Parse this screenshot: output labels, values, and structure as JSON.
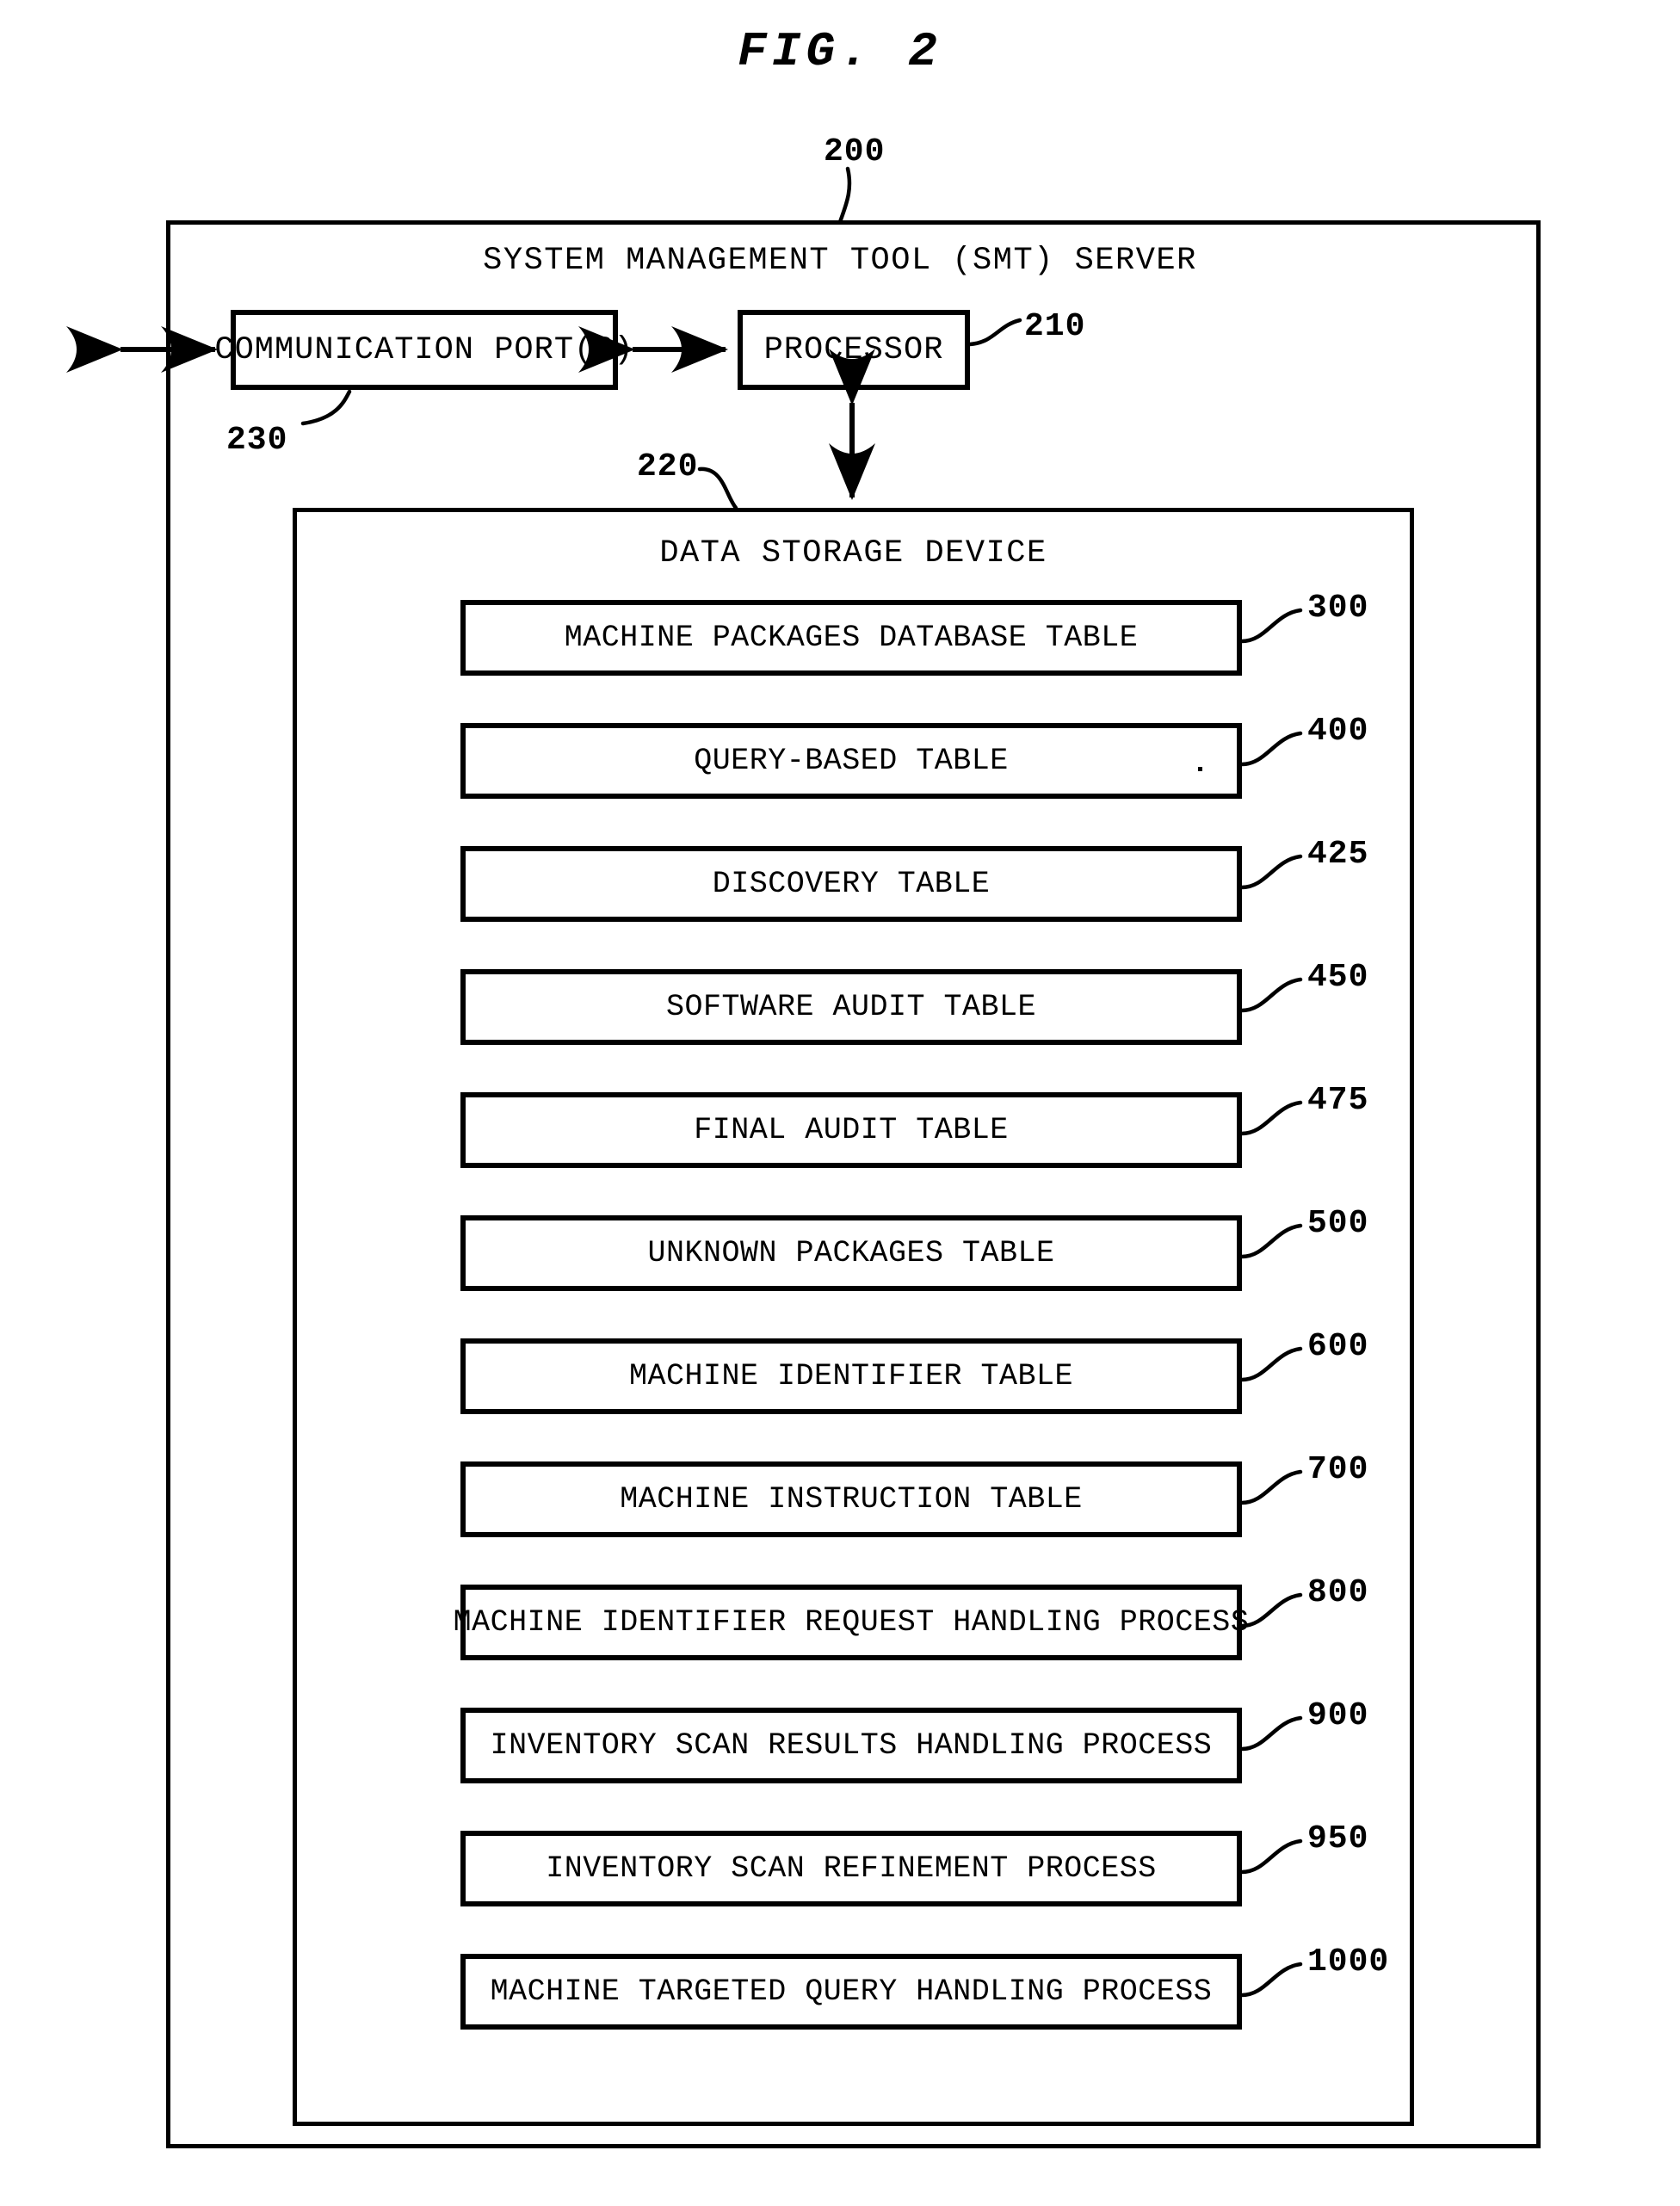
{
  "figure": {
    "title": "FIG. 2",
    "top_reference": "200"
  },
  "smt_server": {
    "title": "SYSTEM MANAGEMENT TOOL (SMT) SERVER",
    "reference": "200"
  },
  "hardware": {
    "communication_port": {
      "label": "COMMUNICATION PORT(S)",
      "reference": "230"
    },
    "processor": {
      "label": "PROCESSOR",
      "reference": "210"
    }
  },
  "data_storage_device": {
    "title": "DATA STORAGE DEVICE",
    "reference": "220",
    "items": [
      {
        "label": "MACHINE PACKAGES DATABASE TABLE",
        "reference": "300",
        "artifact_dot": false
      },
      {
        "label": "QUERY-BASED TABLE",
        "reference": "400",
        "artifact_dot": true
      },
      {
        "label": "DISCOVERY TABLE",
        "reference": "425",
        "artifact_dot": false
      },
      {
        "label": "SOFTWARE AUDIT TABLE",
        "reference": "450",
        "artifact_dot": false
      },
      {
        "label": "FINAL AUDIT TABLE",
        "reference": "475",
        "artifact_dot": false
      },
      {
        "label": "UNKNOWN PACKAGES TABLE",
        "reference": "500",
        "artifact_dot": false
      },
      {
        "label": "MACHINE IDENTIFIER TABLE",
        "reference": "600",
        "artifact_dot": false
      },
      {
        "label": "MACHINE INSTRUCTION TABLE",
        "reference": "700",
        "artifact_dot": false
      },
      {
        "label": "MACHINE IDENTIFIER REQUEST HANDLING PROCESS",
        "reference": "800",
        "artifact_dot": false
      },
      {
        "label": "INVENTORY SCAN RESULTS HANDLING PROCESS",
        "reference": "900",
        "artifact_dot": false
      },
      {
        "label": "INVENTORY SCAN REFINEMENT PROCESS",
        "reference": "950",
        "artifact_dot": false
      },
      {
        "label": "MACHINE TARGETED QUERY HANDLING PROCESS",
        "reference": "1000",
        "artifact_dot": false
      }
    ]
  },
  "colors": {
    "ink": "#000000",
    "paper": "#ffffff"
  }
}
